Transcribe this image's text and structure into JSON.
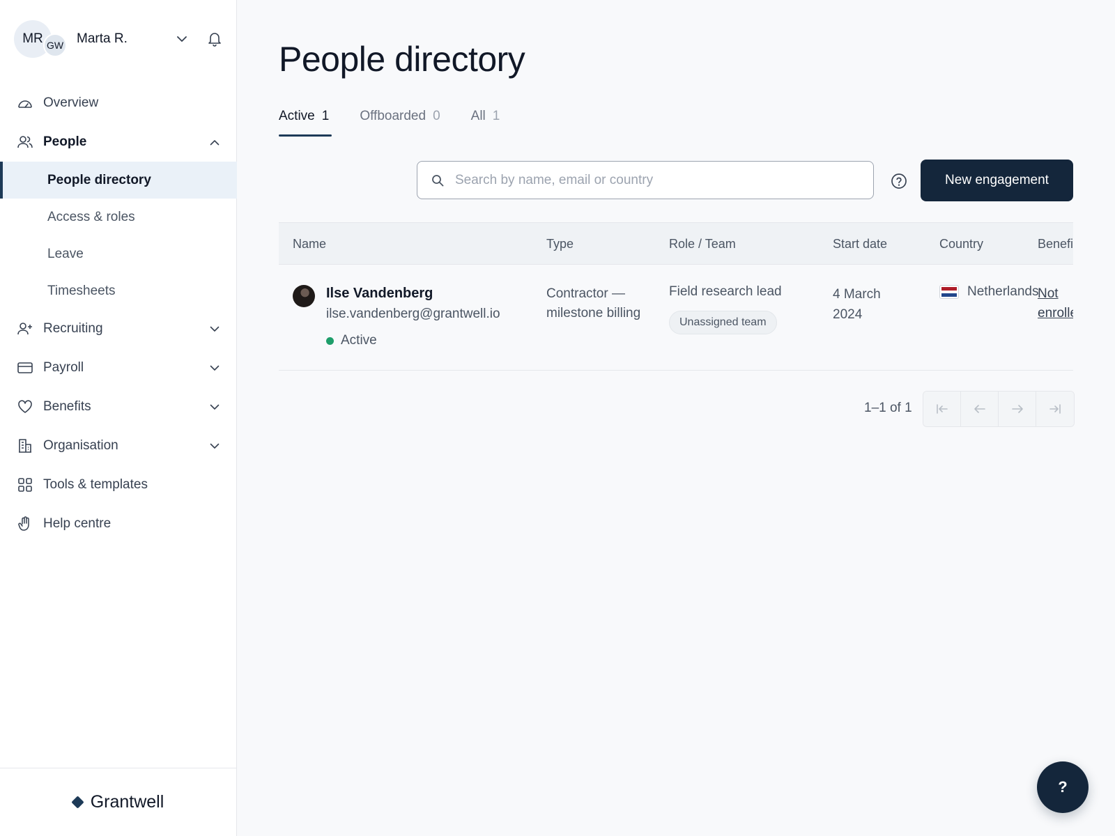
{
  "user": {
    "initials": "MR",
    "org_initials": "GW",
    "name": "Marta R."
  },
  "nav": {
    "overview": "Overview",
    "people": "People",
    "people_sub": {
      "directory": "People directory",
      "access": "Access & roles",
      "leave": "Leave",
      "timesheets": "Timesheets"
    },
    "recruiting": "Recruiting",
    "payroll": "Payroll",
    "benefits": "Benefits",
    "organisation": "Organisation",
    "tools": "Tools & templates",
    "help": "Help centre"
  },
  "brand": {
    "name": "Grantwell",
    "color": "#1d3a57"
  },
  "page": {
    "title": "People directory"
  },
  "tabs": [
    {
      "label": "Active",
      "count": "1"
    },
    {
      "label": "Offboarded",
      "count": "0"
    },
    {
      "label": "All",
      "count": "1"
    }
  ],
  "search": {
    "placeholder": "Search by name, email or country",
    "value": ""
  },
  "actions": {
    "new_engagement": "New engagement",
    "fab_label": "?"
  },
  "table": {
    "columns": [
      "Name",
      "Type",
      "Role / Team",
      "Start date",
      "Country",
      "Benefits"
    ],
    "rows": [
      {
        "name": "Ilse Vandenberg",
        "email": "ilse.vandenberg@grantwell.io",
        "status": "Active",
        "type": "Contractor — milestone billing",
        "role": "Field research lead",
        "team": "Unassigned team",
        "start_date": "4 March 2024",
        "country": "Netherlands",
        "benefits": "Not enrolled"
      }
    ]
  },
  "pagination": {
    "summary": "1–1 of 1"
  },
  "colors": {
    "primary": "#14263b",
    "active_status": "#1e9e6a",
    "active_nav_bg": "#eaf1f8"
  }
}
